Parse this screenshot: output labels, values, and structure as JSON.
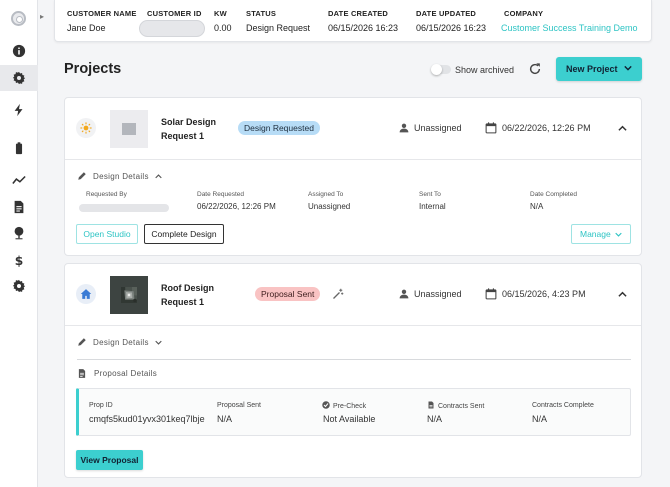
{
  "header": {
    "columns": [
      {
        "label": "CUSTOMER NAME",
        "value": "Jane Doe"
      },
      {
        "label": "CUSTOMER ID",
        "value": ""
      },
      {
        "label": "KW",
        "value": "0.00"
      },
      {
        "label": "STATUS",
        "value": "Design Request"
      },
      {
        "label": "DATE CREATED",
        "value": "06/15/2026 16:23"
      },
      {
        "label": "DATE UPDATED",
        "value": "06/15/2026 16:23"
      },
      {
        "label": "COMPANY",
        "value": "Customer Success Training Demo"
      }
    ]
  },
  "sidebar": {
    "items": [
      {
        "icon": "info-icon"
      },
      {
        "icon": "settings-gear-icon",
        "active": true
      },
      {
        "icon": "lightning-icon"
      },
      {
        "icon": "battery-icon"
      },
      {
        "icon": "trend-line-icon"
      },
      {
        "icon": "document-icon"
      },
      {
        "icon": "map-pin-icon"
      },
      {
        "icon": "dollar-icon"
      },
      {
        "icon": "gear-icon"
      }
    ]
  },
  "projects": {
    "title": "Projects",
    "show_archived_label": "Show archived",
    "show_archived_on": false,
    "new_project_label": "New Project"
  },
  "cards": [
    {
      "name": "Solar Design Request 1",
      "type_icon": "sun-icon",
      "status": "Design Requested",
      "assignee": "Unassigned",
      "date": "06/22/2026, 12:26 PM",
      "details_label": "Design Details",
      "details": {
        "requested_by_label": "Requested By",
        "requested_by": "",
        "date_requested_label": "Date Requested",
        "date_requested": "06/22/2026, 12:26 PM",
        "assigned_to_label": "Assigned To",
        "assigned_to": "Unassigned",
        "sent_to_label": "Sent To",
        "sent_to": "Internal",
        "date_completed_label": "Date Completed",
        "date_completed": "N/A"
      },
      "open_studio_label": "Open Studio",
      "complete_design_label": "Complete Design",
      "manage_label": "Manage"
    },
    {
      "name": "Roof Design Request 1",
      "type_icon": "home-icon",
      "status": "Proposal Sent",
      "assignee": "Unassigned",
      "date": "06/15/2026, 4:23 PM",
      "details_label": "Design Details",
      "proposal_details_label": "Proposal Details",
      "proposal": {
        "prop_id_label": "Prop ID",
        "prop_id": "cmqfs5kud01yvx301keq7lbje",
        "proposal_sent_label": "Proposal Sent",
        "proposal_sent": "N/A",
        "precheck_label": "Pre-Check",
        "precheck": "Not Available",
        "contracts_sent_label": "Contracts Sent",
        "contracts_sent": "N/A",
        "contracts_complete_label": "Contracts Complete",
        "contracts_complete": "N/A"
      },
      "view_proposal_label": "View Proposal"
    }
  ],
  "colors": {
    "accent": "#3ccfcf",
    "badge_design_requested": "#b7dcf6",
    "badge_proposal_sent": "#f9c3c3",
    "link": "#2ec4c4"
  }
}
